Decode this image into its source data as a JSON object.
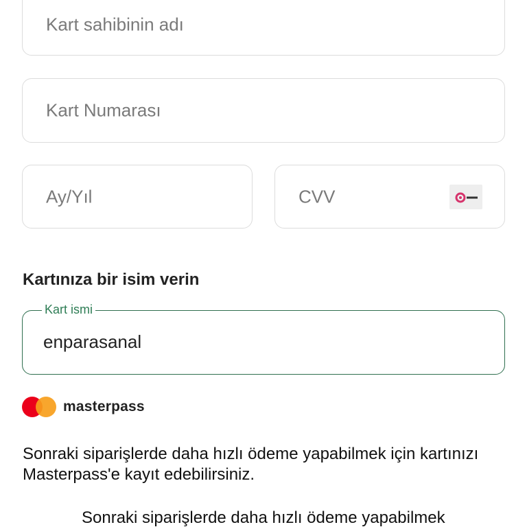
{
  "form": {
    "cardholder_placeholder": "Kart sahibinin adı",
    "card_number_placeholder": "Kart Numarası",
    "expiry_placeholder": "Ay/Yıl",
    "cvv_placeholder": "CVV",
    "cvv_icon": "card-cvv-icon"
  },
  "card_name_section": {
    "title": "Kartınıza bir isim verin",
    "field_label": "Kart ismi",
    "field_value": "enparasanal"
  },
  "masterpass": {
    "brand": "masterpass",
    "logo_icon": "mastercard-logo-icon",
    "info_text": "Sonraki siparişlerde daha hızlı ödeme yapabilmek için kartınızı Masterpass'e kayıt edebilirsiniz.",
    "checkbox_text": "Sonraki siparişlerde daha hızlı ödeme yapabilmek"
  },
  "colors": {
    "accent_green": "#2e6e4e",
    "border_gray": "#dcdcdc",
    "mastercard_red": "#eb001b",
    "mastercard_orange": "#f79e1b",
    "cvv_icon_pink": "#d6336c"
  }
}
